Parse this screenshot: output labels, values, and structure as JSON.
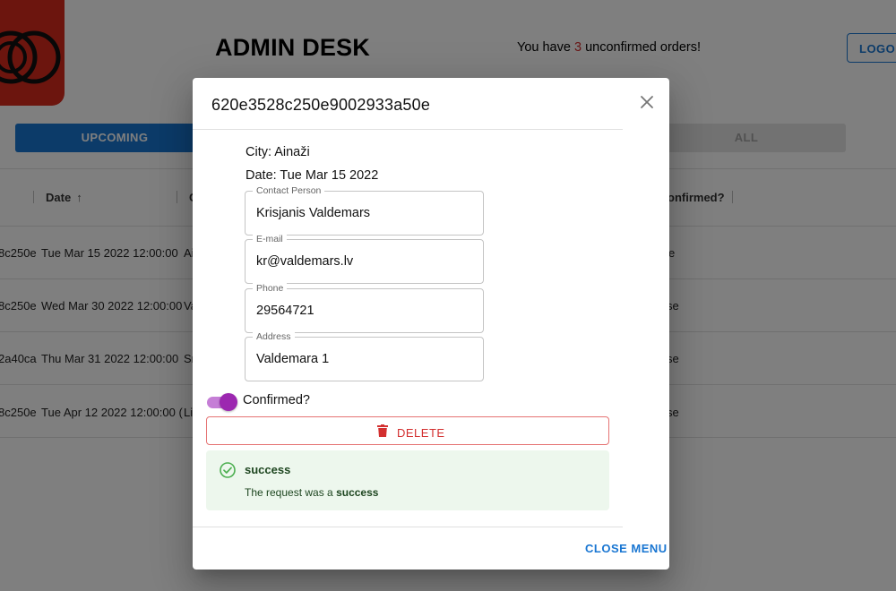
{
  "app": {
    "title": "ADMIN DESK",
    "notice_prefix": "You have ",
    "notice_count": "3",
    "notice_suffix": " unconfirmed orders!",
    "logout_label": "LOGOUT"
  },
  "tabs": [
    {
      "label": "UPCOMING",
      "active": true
    },
    {
      "label": "ALL",
      "active": false
    }
  ],
  "grid": {
    "columns": [
      {
        "label": ""
      },
      {
        "label": "Date",
        "sort": "ascending"
      },
      {
        "label": "C"
      },
      {
        "label": "onfirmed?"
      }
    ],
    "rows": [
      {
        "id": "8c250e",
        "date": "Tue Mar 15 2022 12:00:00",
        "city": "Ai",
        "confirmed": "e"
      },
      {
        "id": "8c250e",
        "date": "Wed Mar 30 2022 12:00:00",
        "city": "Va",
        "confirmed": "se"
      },
      {
        "id": "2a40ca",
        "date": "Thu Mar 31 2022 12:00:00",
        "city": "Sr",
        "confirmed": "se"
      },
      {
        "id": "8c250e",
        "date": "Tue Apr 12 2022 12:00:00 (",
        "city": "Li",
        "confirmed": "se"
      }
    ]
  },
  "dialog": {
    "title": "620e3528c250e9002933a50e",
    "city_line": "City: Ainaži",
    "date_line": "Date: Tue Mar 15 2022",
    "fields": [
      {
        "label": "Contact Person",
        "value": "Krisjanis Valdemars"
      },
      {
        "label": "E-mail",
        "value": "kr@valdemars.lv"
      },
      {
        "label": "Phone",
        "value": "29564721"
      },
      {
        "label": "Address",
        "value": "Valdemara 1"
      }
    ],
    "confirmed_label": "Confirmed?",
    "confirmed": true,
    "delete_label": "DELETE",
    "alert": {
      "severity": "success",
      "title": "success",
      "message_prefix": "The request was a ",
      "message_bold": "success"
    },
    "close_label": "CLOSE MENU"
  },
  "colors": {
    "primary": "#1976d2",
    "danger": "#d32f2f",
    "toggle": "#9c27b0",
    "success_bg": "#edf7ed",
    "success_icon": "#4caf50",
    "logo": "#d92a1c"
  },
  "icons": {
    "logo": "logo-mark",
    "sort": "arrow-up-icon",
    "close": "close-icon",
    "delete": "trash-icon",
    "alert": "check-circle-icon"
  }
}
